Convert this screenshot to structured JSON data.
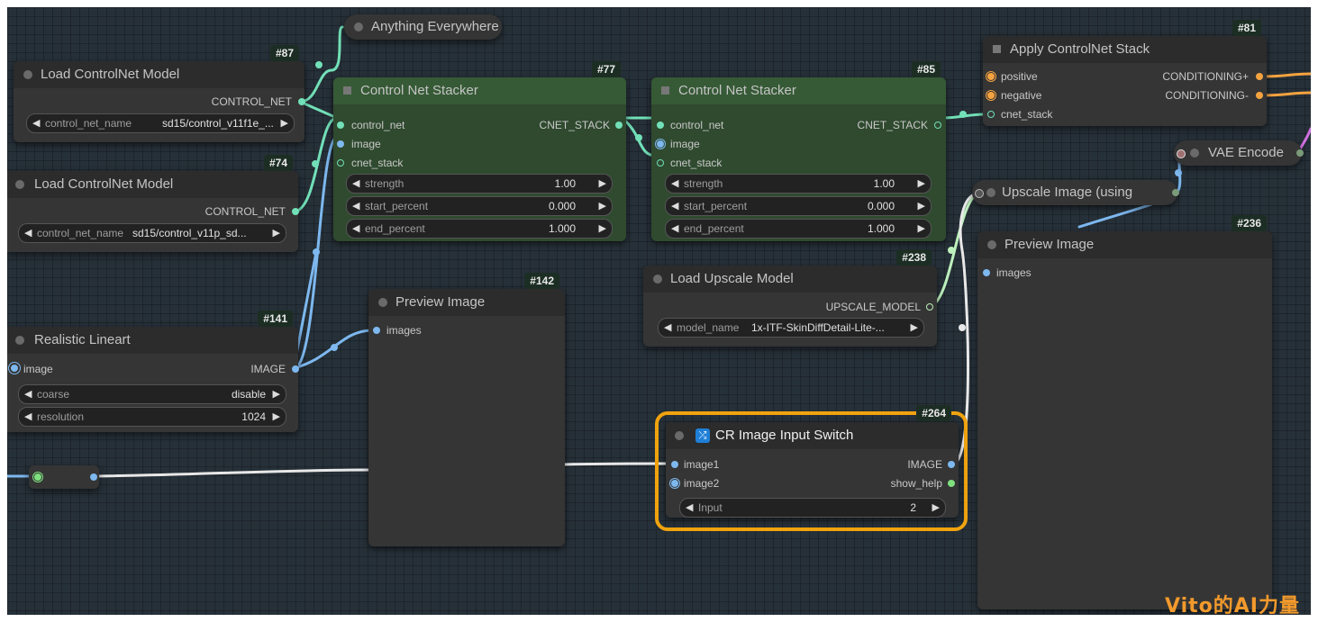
{
  "watermark": "Vito的AI力量",
  "colors": {
    "image": "#7db8ef",
    "control_net": "#72e0b8",
    "conditioning": "#f5a340",
    "upscale_model": "#bdf0bd",
    "highlight": "#f0a30f"
  },
  "nodes": {
    "anything_everywhere": {
      "title": "Anything Everywhere"
    },
    "load_cn_87": {
      "id": "#87",
      "title": "Load ControlNet Model",
      "output": "CONTROL_NET",
      "widget_label": "control_net_name",
      "widget_value": "sd15/control_v11f1e_..."
    },
    "load_cn_74": {
      "id": "#74",
      "title": "Load ControlNet Model",
      "output": "CONTROL_NET",
      "widget_label": "control_net_name",
      "widget_value": "sd15/control_v11p_sd..."
    },
    "realistic_lineart": {
      "id": "#141",
      "title": "Realistic Lineart",
      "input": "image",
      "output": "IMAGE",
      "widgets": [
        {
          "label": "coarse",
          "value": "disable"
        },
        {
          "label": "resolution",
          "value": "1024"
        }
      ]
    },
    "stacker_77": {
      "id": "#77",
      "title": "Control Net Stacker",
      "inputs": [
        "control_net",
        "image",
        "cnet_stack"
      ],
      "output": "CNET_STACK",
      "widgets": [
        {
          "label": "strength",
          "value": "1.00"
        },
        {
          "label": "start_percent",
          "value": "0.000"
        },
        {
          "label": "end_percent",
          "value": "1.000"
        }
      ]
    },
    "stacker_85": {
      "id": "#85",
      "title": "Control Net Stacker",
      "inputs": [
        "control_net",
        "image",
        "cnet_stack"
      ],
      "output": "CNET_STACK",
      "widgets": [
        {
          "label": "strength",
          "value": "1.00"
        },
        {
          "label": "start_percent",
          "value": "0.000"
        },
        {
          "label": "end_percent",
          "value": "1.000"
        }
      ]
    },
    "apply_cn_stack": {
      "id": "#81",
      "title": "Apply ControlNet Stack",
      "inputs": [
        "positive",
        "negative",
        "cnet_stack"
      ],
      "outputs": [
        "CONDITIONING+",
        "CONDITIONING-"
      ]
    },
    "vae_encode": {
      "title": "VAE Encode"
    },
    "upscale_image": {
      "title": "Upscale Image (using"
    },
    "preview_142": {
      "id": "#142",
      "title": "Preview Image",
      "input": "images"
    },
    "preview_236": {
      "id": "#236",
      "title": "Preview Image",
      "input": "images"
    },
    "load_upscale": {
      "id": "#238",
      "title": "Load Upscale Model",
      "output": "UPSCALE_MODEL",
      "widget_label": "model_name",
      "widget_value": "1x-ITF-SkinDiffDetail-Lite-..."
    },
    "cr_switch": {
      "id": "#264",
      "title": "CR Image Input Switch",
      "inputs": [
        "image1",
        "image2"
      ],
      "outputs": [
        "IMAGE",
        "show_help"
      ],
      "widget_label": "Input",
      "widget_value": "2"
    }
  }
}
